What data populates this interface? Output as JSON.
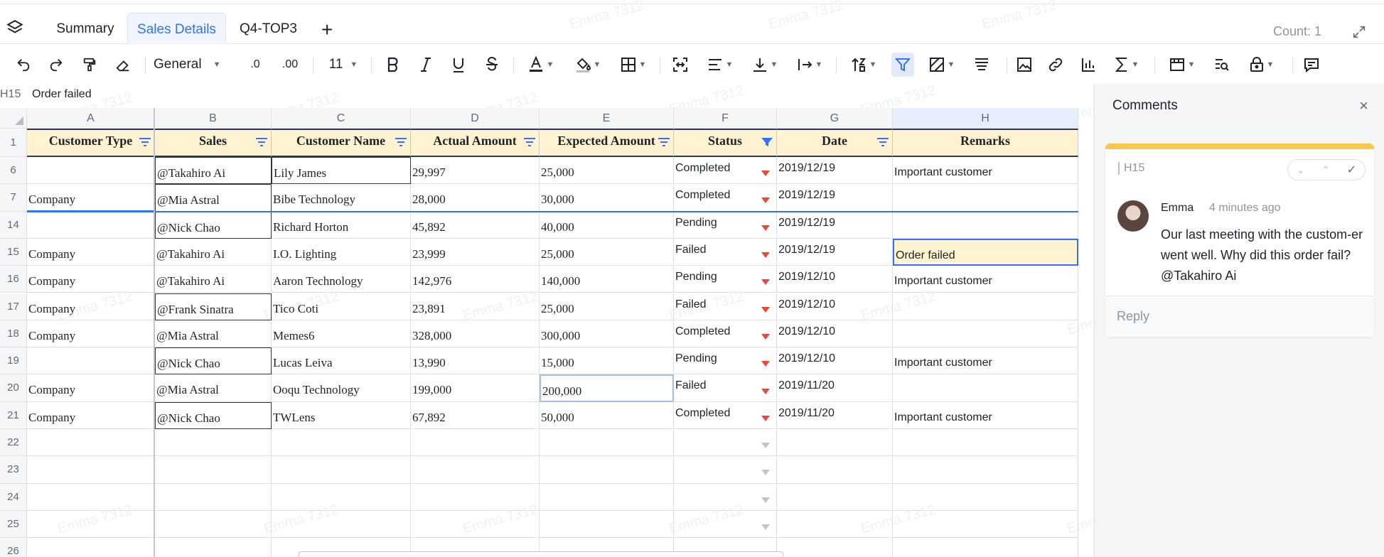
{
  "tabs": [
    {
      "label": "Summary"
    },
    {
      "label": "Sales Details"
    },
    {
      "label": "Q4-TOP3"
    }
  ],
  "tab_add_label": "+",
  "count_label": "Count: 1",
  "toolbar": {
    "number_format": "General",
    "decimal_decrease": ".0",
    "decimal_increase": ".00",
    "font_size": "11",
    "icons": [
      "undo-icon",
      "redo-icon",
      "format-painter-icon",
      "eraser-icon",
      "bold-icon",
      "italic-icon",
      "underline-icon",
      "strikethrough-icon",
      "font-color-icon",
      "fill-color-icon",
      "borders-icon",
      "merge-icon",
      "align-icon",
      "vertical-align-icon",
      "text-wrap-icon",
      "sort-icon",
      "filter-icon",
      "conditional-format-icon",
      "freeze-icon",
      "image-icon",
      "link-icon",
      "chart-icon",
      "sum-icon",
      "dropdown-list-icon",
      "find-icon",
      "protect-icon",
      "comment-icon"
    ]
  },
  "formula_bar": {
    "cell_ref": "H15",
    "content": "Order failed"
  },
  "columns": [
    "A",
    "B",
    "C",
    "D",
    "E",
    "F",
    "G",
    "H"
  ],
  "headers": [
    "Customer Type",
    "Sales",
    "Customer Name",
    "Actual Amount",
    "Expected Amount",
    "Status",
    "Date",
    "Remarks"
  ],
  "header_row_number": "1",
  "rows": [
    {
      "num": "6",
      "type": "",
      "sales": "@Takahiro Ai",
      "name": "Lily James",
      "actual": "29,997",
      "expected": "25,000",
      "status": "Completed",
      "date": "2019/12/19",
      "remarks": "Important customer"
    },
    {
      "num": "7",
      "type": "Company",
      "sales": "@Mia Astral",
      "name": "Bibe Technology",
      "actual": "28,000",
      "expected": "30,000",
      "status": "Completed",
      "date": "2019/12/19",
      "remarks": ""
    },
    {
      "num": "14",
      "type": "",
      "sales": "@Nick Chao",
      "name": "Richard Horton",
      "actual": "45,892",
      "expected": "40,000",
      "status": "Pending",
      "date": "2019/12/19",
      "remarks": ""
    },
    {
      "num": "15",
      "type": "Company",
      "sales": "@Takahiro Ai",
      "name": "I.O. Lighting",
      "actual": "23,999",
      "expected": "25,000",
      "status": "Failed",
      "date": "2019/12/19",
      "remarks": "Order failed"
    },
    {
      "num": "16",
      "type": "Company",
      "sales": "@Takahiro Ai",
      "name": "Aaron Technology",
      "actual": "142,976",
      "expected": "140,000",
      "status": "Pending",
      "date": "2019/12/10",
      "remarks": "Important customer"
    },
    {
      "num": "17",
      "type": "Company",
      "sales": "@Frank Sinatra",
      "name": "Tico Coti",
      "actual": "23,891",
      "expected": "25,000",
      "status": "Failed",
      "date": "2019/12/10",
      "remarks": ""
    },
    {
      "num": "18",
      "type": "Company",
      "sales": "@Mia Astral",
      "name": "Memes6",
      "actual": "328,000",
      "expected": "300,000",
      "status": "Completed",
      "date": "2019/12/10",
      "remarks": ""
    },
    {
      "num": "19",
      "type": "",
      "sales": "@Nick Chao",
      "name": "Lucas Leiva",
      "actual": "13,990",
      "expected": "15,000",
      "status": "Pending",
      "date": "2019/12/10",
      "remarks": "Important customer"
    },
    {
      "num": "20",
      "type": "Company",
      "sales": "@Mia Astral",
      "name": "Ooqu Technology",
      "actual": "199,000",
      "expected": "200,000",
      "status": "Failed",
      "date": "2019/11/20",
      "remarks": ""
    },
    {
      "num": "21",
      "type": "Company",
      "sales": "@Nick Chao",
      "name": "TWLens",
      "actual": "67,892",
      "expected": "50,000",
      "status": "Completed",
      "date": "2019/11/20",
      "remarks": "Important customer"
    }
  ],
  "empty_rows": [
    "22",
    "23",
    "24",
    "25",
    "26"
  ],
  "watermark": "Emma 7312",
  "comments": {
    "title": "Comments",
    "close": "×",
    "ref": "H15",
    "author": "Emma",
    "time": "4 minutes ago",
    "text": "Our last meeting with the custom-er went well. Why did this order fail? @Takahiro Ai",
    "reply_placeholder": "Reply"
  },
  "colors": {
    "accent": "#3370ff",
    "header_fill": "#fff3d1",
    "comment_bar": "#f9c84a",
    "dropdown": "#e64a3b"
  }
}
